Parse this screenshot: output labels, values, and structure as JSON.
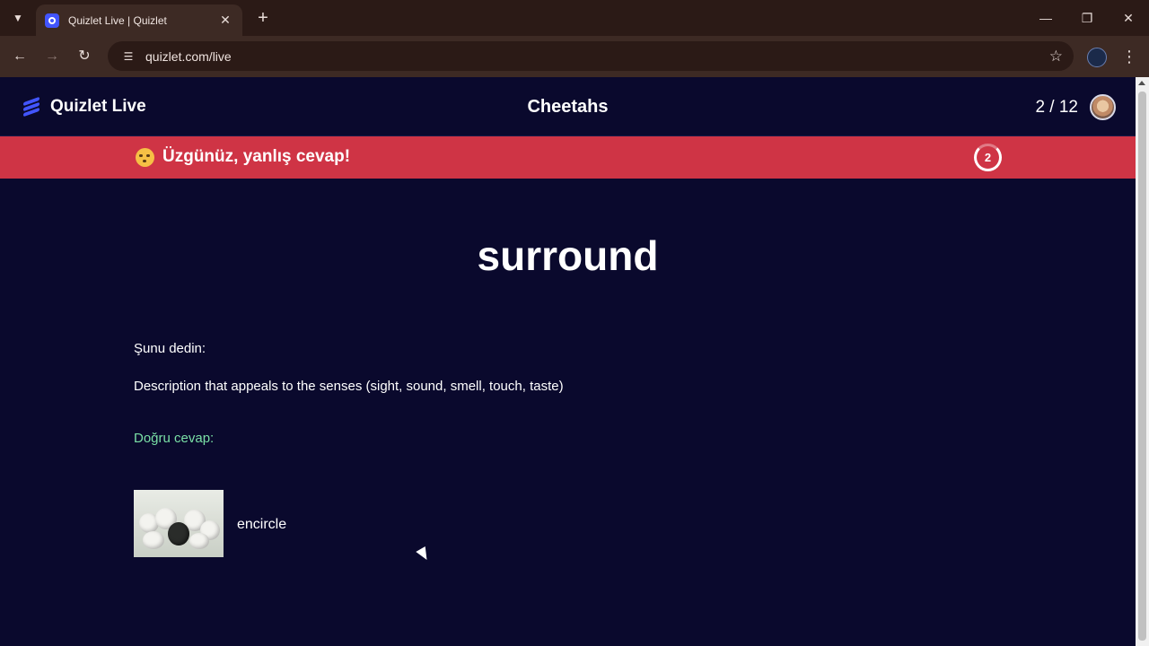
{
  "browser": {
    "tab_title": "Quizlet Live | Quizlet",
    "url": "quizlet.com/live",
    "icons": {
      "tab_search": "chevron-down-icon",
      "close_tab": "close-icon",
      "new_tab": "plus-icon",
      "minimize": "minimize-icon",
      "restore": "restore-icon",
      "close_window": "close-icon",
      "back": "arrow-left-icon",
      "forward": "arrow-right-icon",
      "reload": "reload-icon",
      "site_info": "tune-icon",
      "bookmark": "star-icon",
      "menu": "kebab-menu-icon"
    }
  },
  "header": {
    "logo_text": "Quizlet Live",
    "team_name": "Cheetahs",
    "progress": "2 / 12"
  },
  "banner": {
    "message": "Üzgünüz, yanlış cevap!",
    "timer_value": "2",
    "color": "#cf3445"
  },
  "question": {
    "term": "surround"
  },
  "result": {
    "you_said_label": "Şunu dedin:",
    "you_said_answer": "Description that appeals to the senses (sight, sound, smell, touch, taste)",
    "correct_label": "Doğru cevap:",
    "correct_answer": "encircle",
    "correct_color": "#7ae0a6"
  },
  "colors": {
    "page_bg": "#0a092d",
    "brand": "#4255ff"
  }
}
